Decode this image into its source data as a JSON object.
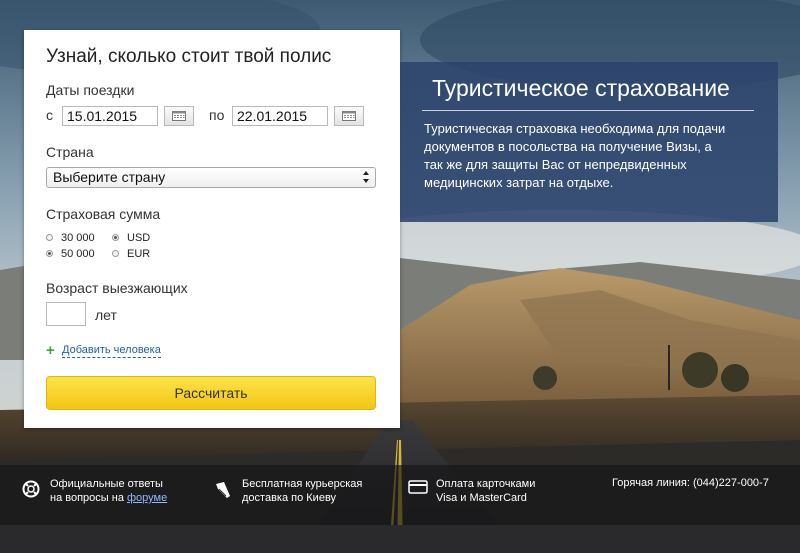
{
  "form": {
    "title": "Узнай, сколько стоит твой полис",
    "dates_label": "Даты поездки",
    "from_prefix": "с",
    "from_value": "15.01.2015",
    "to_prefix": "по",
    "to_value": "22.01.2015",
    "country_label": "Страна",
    "country_selected": "Выберите страну",
    "sum_label": "Страховая сумма",
    "sums": [
      {
        "label": "30 000",
        "checked": false
      },
      {
        "label": "50 000",
        "checked": true
      }
    ],
    "currencies": [
      {
        "label": "USD",
        "checked": true
      },
      {
        "label": "EUR",
        "checked": false
      }
    ],
    "age_label": "Возраст выезжающих",
    "age_value": "",
    "age_unit": "лет",
    "add_person": "Добавить человека",
    "calculate": "Рассчитать"
  },
  "info": {
    "title": "Туристическое страхование",
    "text": "Туристическая страховка необходима для подачи документов в посольства на получение Визы, а так же для защиты Вас от непредвиденных медицинских затрат на отдыхе."
  },
  "footer": {
    "f1_line1": "Официальные ответы",
    "f1_line2": "на вопросы на",
    "f1_link": "форуме",
    "f2_line1": "Бесплатная курьерская",
    "f2_line2": "доставка по Киеву",
    "f3_line1": "Оплата карточками",
    "f3_line2": "Visa и MasterCard",
    "hotline": "Горячая линия: (044)227-000-7"
  },
  "colors": {
    "button_yellow": "#f8d52c",
    "info_panel": "#2c436c",
    "link_blue": "#1f5ea8",
    "plus_green": "#3aa635"
  }
}
